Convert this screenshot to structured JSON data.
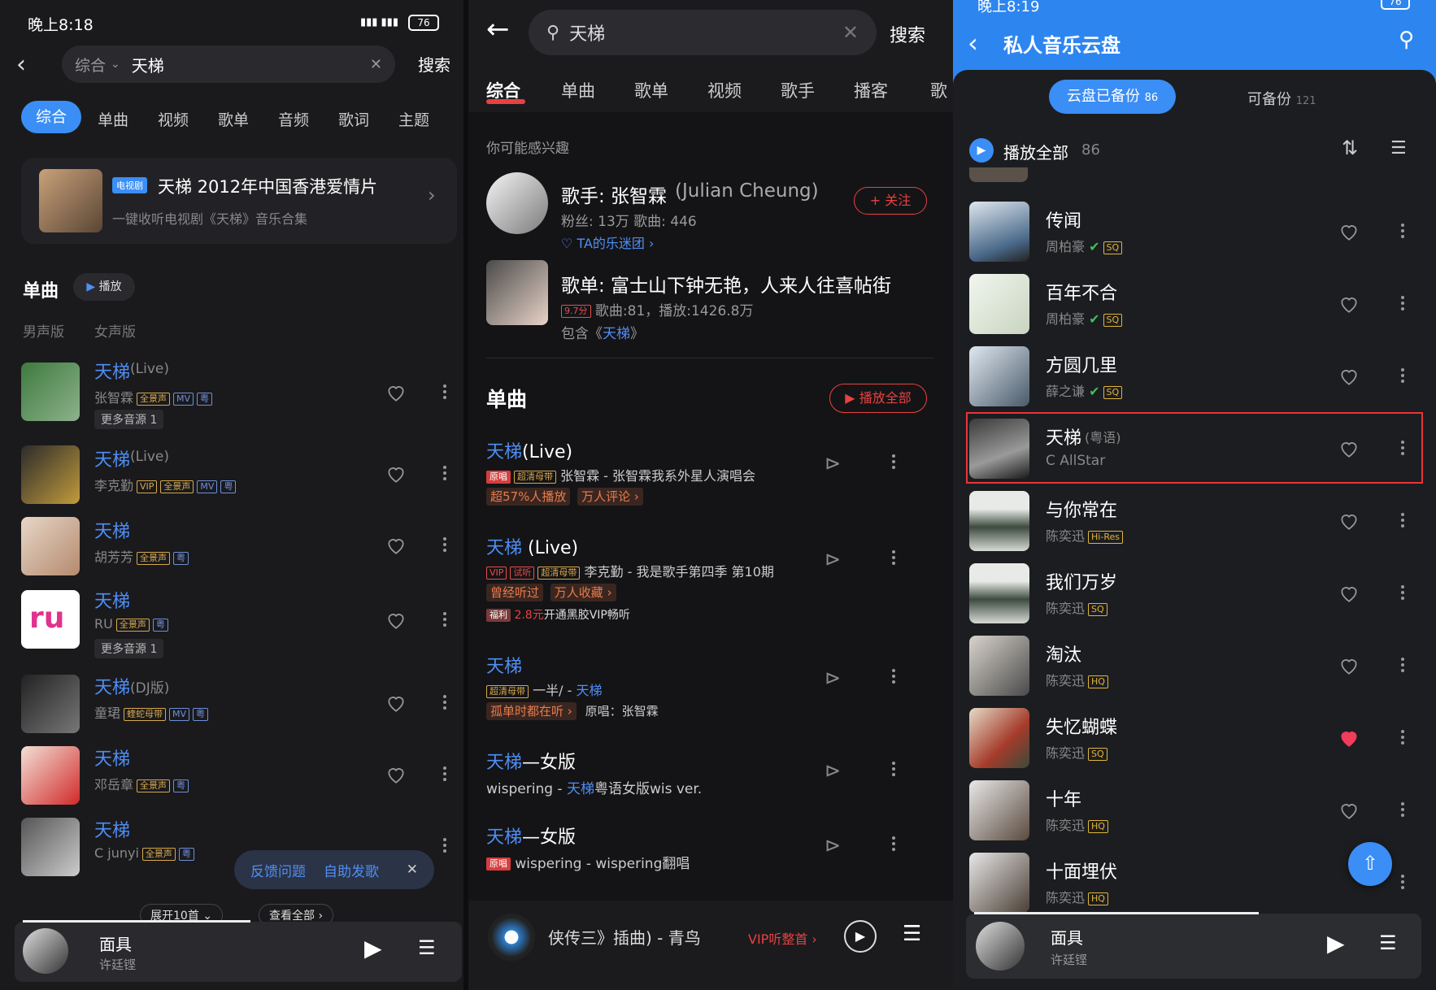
{
  "p1": {
    "status": {
      "time": "晚上8:18",
      "battery": "76"
    },
    "search": {
      "scope": "综合",
      "query": "天梯",
      "button": "搜索"
    },
    "tabs": [
      "综合",
      "单曲",
      "视频",
      "歌单",
      "音频",
      "歌词",
      "主题"
    ],
    "banner": {
      "tag": "电视剧",
      "title": "天梯 2012年中国香港爱情片",
      "sub": "一键收听电视剧《天梯》音乐合集"
    },
    "section": {
      "title": "单曲",
      "play": "播放",
      "filters": [
        "男声版",
        "女声版"
      ]
    },
    "songs": [
      {
        "title": "天梯",
        "suffix": "(Live)",
        "artist": "张智霖",
        "more": "更多音源 1",
        "badges": [
          "全景声",
          "MV",
          "粤"
        ]
      },
      {
        "title": "天梯",
        "suffix": "(Live)",
        "artist": "李克勤",
        "badges": [
          "VIP",
          "全景声",
          "MV",
          "粤"
        ]
      },
      {
        "title": "天梯",
        "suffix": "",
        "artist": "胡芳芳",
        "badges": [
          "全景声",
          "粤"
        ]
      },
      {
        "title": "天梯",
        "suffix": "",
        "artist": "RU",
        "more": "更多音源 1",
        "badges": [
          "全景声",
          "粤"
        ]
      },
      {
        "title": "天梯",
        "suffix": "(DJ版)",
        "artist": "童珺",
        "badges": [
          "蝰蛇母带",
          "MV",
          "粤"
        ]
      },
      {
        "title": "天梯",
        "suffix": "",
        "artist": "邓岳章",
        "badges": [
          "全景声",
          "粤"
        ]
      },
      {
        "title": "天梯",
        "suffix": "",
        "artist": "C junyi",
        "badges": [
          "全景声",
          "粤"
        ]
      }
    ],
    "popup": {
      "feedback": "反馈问题",
      "self": "自助发歌"
    },
    "expand": "展开10首",
    "view_all": "查看全部",
    "player": {
      "title": "面具",
      "artist": "许廷铿"
    }
  },
  "p2": {
    "search": {
      "query": "天梯",
      "button": "搜索"
    },
    "tabs": [
      "综合",
      "单曲",
      "歌单",
      "视频",
      "歌手",
      "播客",
      "歌"
    ],
    "interest": "你可能感兴趣",
    "singer": {
      "title": "歌手: 张智霖",
      "en": "(Julian Cheung)",
      "meta": "粉丝: 13万  歌曲: 446",
      "fan": "TA的乐迷团",
      "follow": "+ 关注"
    },
    "playlist": {
      "title": "歌单: 富士山下钟无艳，人来人往喜帖街",
      "score": "9.7分",
      "meta": "歌曲:81，播放:1426.8万",
      "contains_pre": "包含《",
      "contains_hl": "天梯",
      "contains_post": "》"
    },
    "section": {
      "title": "单曲",
      "play_all": "播放全部"
    },
    "songs": [
      {
        "hl": "天梯",
        "rest": "(Live)",
        "badges": [
          "原唱",
          "超清母带"
        ],
        "line": "张智霖 - 张智霖我系外星人演唱会",
        "tags": [
          "超57%人播放",
          "万人评论"
        ]
      },
      {
        "hl": "天梯",
        "rest": " (Live)",
        "badges": [
          "VIP",
          "试听",
          "超清母带"
        ],
        "line": "李克勤 - 我是歌手第四季 第10期",
        "tags": [
          "曾经听过",
          "万人收藏"
        ],
        "promo_tag": "福利",
        "promo_price": "2.8元",
        "promo_text": "开通黑胶VIP畅听"
      },
      {
        "hl": "天梯",
        "rest": "",
        "badges": [
          "超清母带"
        ],
        "line": "一半/ - ",
        "line_hl": "天梯",
        "tags": [
          "孤单时都在听"
        ],
        "extra": "原唱：张智霖"
      },
      {
        "hl": "天梯",
        "rest": "—女版",
        "badges": [],
        "line": "wispering - ",
        "line_hl": "天梯",
        "line_post": "粤语女版wis ver."
      },
      {
        "hl": "天梯",
        "rest": "—女版",
        "badges": [
          "原唱"
        ],
        "line": "wispering - wispering翻唱"
      }
    ],
    "player": {
      "title": "侠传三》插曲) - 青鸟",
      "vip": "VIP听整首"
    }
  },
  "p3": {
    "status": {
      "time": "晚上8:19",
      "battery": "76"
    },
    "title": "私人音乐云盘",
    "tabs": {
      "backed": "云盘已备份",
      "backed_count": "86",
      "avail": "可备份",
      "avail_count": "121"
    },
    "play_all": "播放全部",
    "count": "86",
    "songs": [
      {
        "title": "传闻",
        "artist": "周柏豪",
        "verified": true,
        "q": "SQ"
      },
      {
        "title": "百年不合",
        "artist": "周柏豪",
        "verified": true,
        "q": "SQ"
      },
      {
        "title": "方圆几里",
        "artist": "薛之谦",
        "verified": true,
        "q": "SQ"
      },
      {
        "title": "天梯",
        "note": "(粤语)",
        "artist": "C AllStar",
        "verified": false,
        "q": ""
      },
      {
        "title": "与你常在",
        "artist": "陈奕迅",
        "verified": false,
        "q": "Hi-Res"
      },
      {
        "title": "我们万岁",
        "artist": "陈奕迅",
        "verified": false,
        "q": "SQ"
      },
      {
        "title": "淘汰",
        "artist": "陈奕迅",
        "verified": false,
        "q": "HQ"
      },
      {
        "title": "失忆蝴蝶",
        "artist": "陈奕迅",
        "verified": false,
        "q": "SQ",
        "liked": true
      },
      {
        "title": "十年",
        "artist": "陈奕迅",
        "verified": false,
        "q": "HQ"
      },
      {
        "title": "十面埋伏",
        "artist": "陈奕迅",
        "verified": false,
        "q": "HQ"
      }
    ],
    "player": {
      "title": "面具",
      "artist": "许廷铿"
    }
  },
  "colors": {
    "accent_blue": "#3a8ef6",
    "accent_red": "#e84141",
    "highlight_box": "#e8343a"
  }
}
